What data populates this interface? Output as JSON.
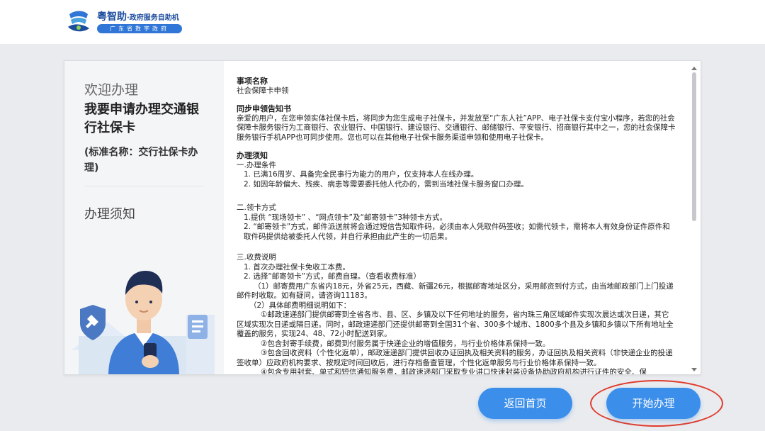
{
  "header": {
    "app_name": "粤智助",
    "app_subtitle": "·政府服务自助机",
    "app_tagline": "广东省数字政府"
  },
  "left": {
    "welcome": "欢迎办理",
    "title": "我要申请办理交通银行社保卡",
    "standard_name": "(标准名称：交行社保卡办理)",
    "notice_label": "办理须知"
  },
  "content": {
    "item_heading": "事项名称",
    "item_value": "社会保障卡申领",
    "sync_heading": "同步申领告知书",
    "sync_text": "亲爱的用户，在您申领实体社保卡后，将同步为您生成电子社保卡，并发放至“广东人社”APP、电子社保卡支付宝小程序，若您的社会保障卡服务银行为工商银行、农业银行、中国银行、建设银行、交通银行、邮储银行、平安银行、招商银行其中之一，您的社会保障卡服务银行手机APP也可同步使用。您也可以在其他电子社保卡服务渠道申领和使用电子社保卡。",
    "notice_heading": "办理须知",
    "s1_title": "一.办理条件",
    "s1_items": [
      "1. 已满16周岁、具备完全民事行为能力的用户，仅支持本人在线办理。",
      "2. 如因年龄偏大、残疾、病患等需要委托他人代办的，需到当地社保卡服务窗口办理。"
    ],
    "s2_title": "二.领卡方式",
    "s2_items": [
      "1.提供 “现场领卡” 、“网点领卡”及“邮寄领卡”3种领卡方式。",
      "2. “邮寄领卡”方式，邮件派送前将会通过短信告知取件码，必须由本人凭取件码签收；如需代领卡，需将本人有效身份证件原件和取件码提供给被委托人代领，并自行承担由此产生的一切后果。"
    ],
    "s3_title": "三.收费说明",
    "s3_item1": "1. 首次办理社保卡免收工本费。",
    "s3_item2": "2. 选择“邮寄领卡”方式，邮费自理。（查看收费标准）",
    "s3_p1": "（1）邮寄费用广东省内18元，外省25元，西藏、新疆26元，根据邮寄地址区分，采用邮资到付方式，由当地邮政部门上门投递邮件时收取。如有疑问，请咨询11183。",
    "s3_p2": "（2）具体邮费明细说明如下：",
    "s3_p3": "①邮政速递部门提供邮寄到全省各市、县、区、乡镇及以下任何地址的服务，省内珠三角区域邮件实现次晨达或次日递，其它区域实现次日递或隔日递。同时，邮政速递部门还提供邮寄到全国31个省、300多个城市、1800多个县及乡镇和乡镇以下所有地址全覆盖的服务，实现24、48、72小时配送到家。",
    "s3_p4": "②包含封寄手续费，邮费到付服务属于快递企业的增值服务，与行业价格体系保持一致。",
    "s3_p5": "③包含回收资料（个性化返单），邮政速递部门提供回收办证回执及相关资料的服务，办证回执及相关资料（非快递企业的投递签收单）应政府机构要求、按规定时间回收后，进行存档备查管理，个性化返单服务与行业价格体系保持一致。",
    "s3_p6": "④包含专用封套、单式和短信通知服务费，邮政速递部门采取专业讲口快速封装设备协助政府机构进行证件的安全、保"
  },
  "buttons": {
    "home": "返回首页",
    "start": "开始办理"
  },
  "colors": {
    "accent": "#3b8eea",
    "highlight": "#e03b2e",
    "brand": "#1d4e9e"
  }
}
